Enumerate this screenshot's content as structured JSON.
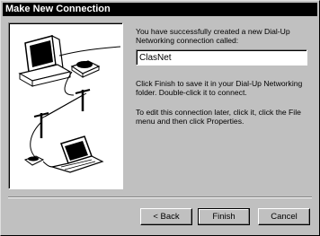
{
  "window": {
    "title": "Make New Connection"
  },
  "intro_text": "You have successfully created a new Dial-Up Networking connection called:",
  "connection_name": {
    "value": "ClasNet"
  },
  "finish_text": "Click Finish to save it in your Dial-Up Networking folder. Double-click it to connect.",
  "edit_text": "To edit this connection later, click it, click the File menu and then click Properties.",
  "buttons": {
    "back": "< Back",
    "finish": "Finish",
    "cancel": "Cancel"
  },
  "illustration": {
    "icons": [
      "desktop-computer-icon",
      "modem-icon",
      "telephone-pole-icon",
      "laptop-computer-icon"
    ]
  }
}
